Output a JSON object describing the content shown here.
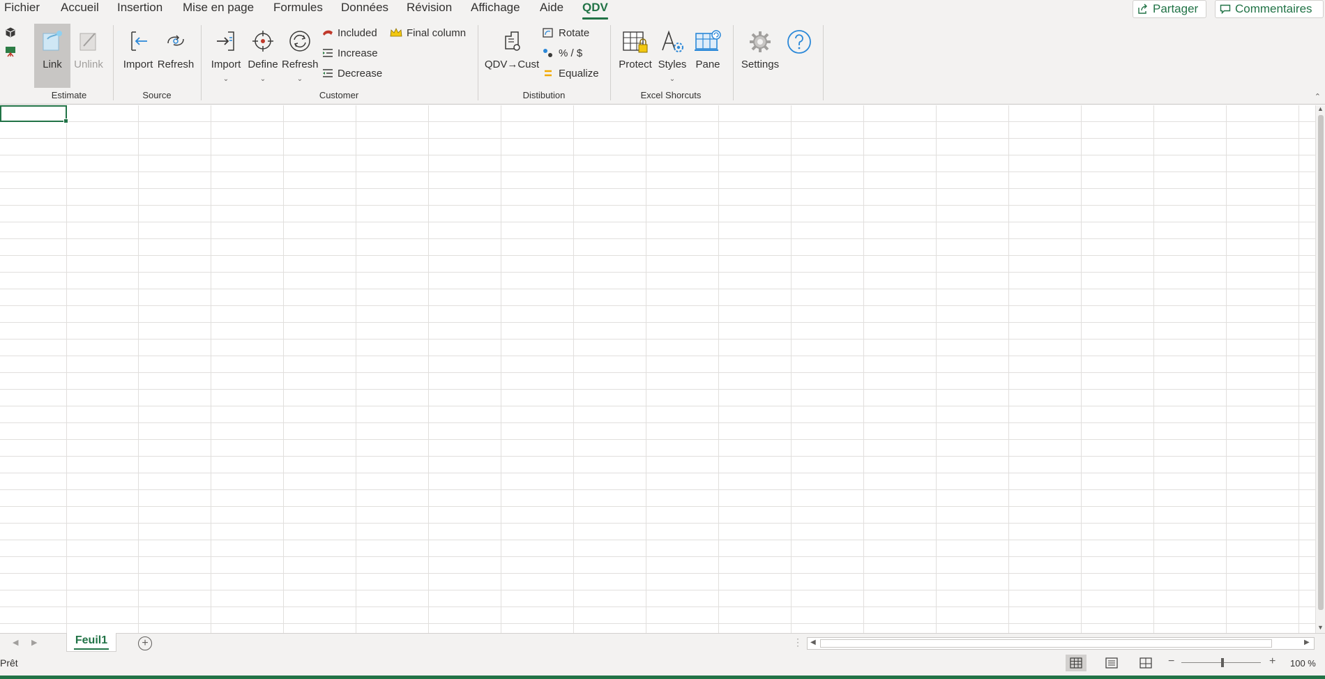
{
  "menu": {
    "tabs": [
      {
        "label": "Fichier"
      },
      {
        "label": "Accueil"
      },
      {
        "label": "Insertion"
      },
      {
        "label": "Mise en page"
      },
      {
        "label": "Formules"
      },
      {
        "label": "Données"
      },
      {
        "label": "Révision"
      },
      {
        "label": "Affichage"
      },
      {
        "label": "Aide"
      },
      {
        "label": "QDV"
      }
    ],
    "active_tab": "QDV",
    "share_label": "Partager",
    "comments_label": "Commentaires"
  },
  "ribbon": {
    "groups": {
      "estimate": {
        "label": "Estimate",
        "link_label": "Link",
        "unlink_label": "Unlink"
      },
      "source": {
        "label": "Source",
        "import_label": "Import",
        "refresh_label": "Refresh"
      },
      "customer": {
        "label": "Customer",
        "import_label": "Import",
        "define_label": "Define",
        "refresh_label": "Refresh",
        "included_label": "Included",
        "increase_label": "Increase",
        "decrease_label": "Decrease",
        "final_column_label": "Final column"
      },
      "distribution": {
        "label": "Distibution",
        "qdv_cust_label": "QDV→Cust",
        "rotate_label": "Rotate",
        "percent_dollar_label": "% / $",
        "equalize_label": "Equalize"
      },
      "excel_shortcuts": {
        "label": "Excel Shorcuts",
        "protect_label": "Protect",
        "styles_label": "Styles",
        "pane_label": "Pane"
      },
      "misc": {
        "settings_label": "Settings"
      }
    }
  },
  "sheet": {
    "active_tab": "Feuil1"
  },
  "status": {
    "ready": "Prêt",
    "zoom": "100 %"
  },
  "colors": {
    "accent": "#217346",
    "ribbon_bg": "#f3f2f1",
    "gridline": "#e1dfdd"
  }
}
